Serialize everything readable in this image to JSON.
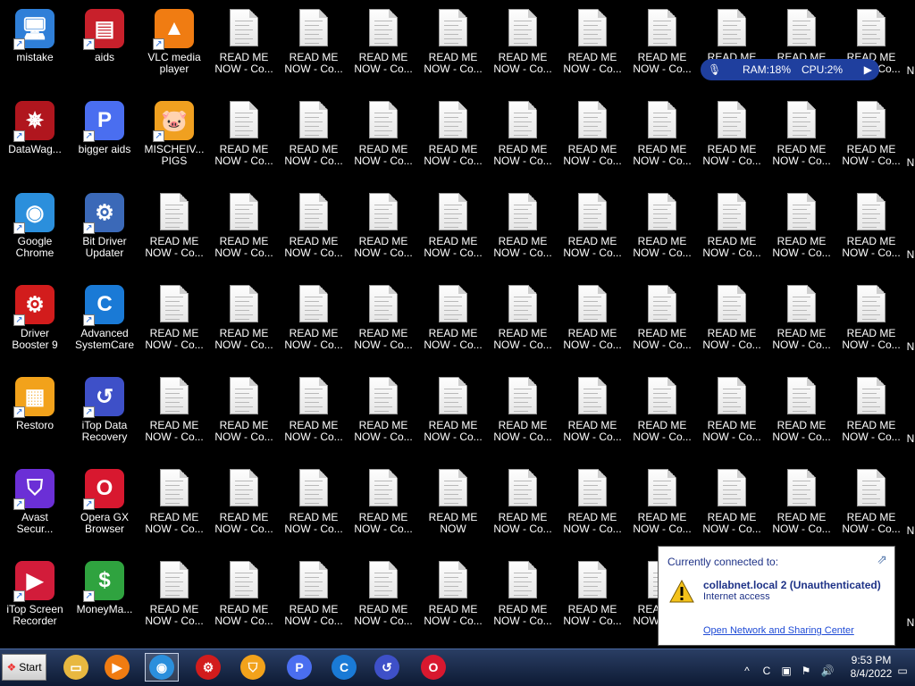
{
  "desktop": {
    "apps": [
      {
        "label": "mistake",
        "icon": "monitor-icon",
        "color": "#2f7fd8",
        "glyph": "🖥"
      },
      {
        "label": "DataWag...",
        "icon": "datawag-star-icon",
        "color": "#b0161e",
        "glyph": "✵"
      },
      {
        "label": "Google\nChrome",
        "icon": "chrome-icon",
        "color": "#2b8fdc",
        "glyph": "◉"
      },
      {
        "label": "Driver\nBooster 9",
        "icon": "driver-booster-icon",
        "color": "#d21c1c",
        "glyph": "⚙"
      },
      {
        "label": "Restoro",
        "icon": "restoro-icon",
        "color": "#f2a21b",
        "glyph": "▦"
      },
      {
        "label": "Avast\nSecur...",
        "icon": "avast-secure-browser-icon",
        "color": "#6b2fd6",
        "glyph": "⛉"
      },
      {
        "label": "iTop Screen\nRecorder",
        "icon": "itop-screen-recorder-icon",
        "color": "#d21c3a",
        "glyph": "▶"
      },
      {
        "label": "aids",
        "icon": "aids-app-icon",
        "color": "#c8202b",
        "glyph": "▤"
      },
      {
        "label": "bigger aids",
        "icon": "p-letter-icon",
        "color": "#4a6ef0",
        "glyph": "P"
      },
      {
        "label": "Bit Driver\nUpdater",
        "icon": "bit-driver-updater-icon",
        "color": "#3b69b8",
        "glyph": "⚙"
      },
      {
        "label": "Advanced\nSystemCare",
        "icon": "advanced-systemcare-icon",
        "color": "#1a7ad6",
        "glyph": "C"
      },
      {
        "label": "iTop Data\nRecovery",
        "icon": "itop-data-recovery-icon",
        "color": "#3e50c8",
        "glyph": "↺"
      },
      {
        "label": "Opera GX\nBrowser",
        "icon": "opera-gx-icon",
        "color": "#d8182f",
        "glyph": "O"
      },
      {
        "label": "MoneyMa...",
        "icon": "money-icon",
        "color": "#2fa33f",
        "glyph": "$"
      },
      {
        "label": "VLC media\nplayer",
        "icon": "vlc-cone-icon",
        "color": "#f07c12",
        "glyph": "▲"
      },
      {
        "label": "MISCHEIV...\nPIGS",
        "icon": "pigs-game-icon",
        "color": "#f0a020",
        "glyph": "🐷"
      }
    ],
    "file_label": "READ ME\nNOW - Co...",
    "file_label_variant": "READ ME\nNOW",
    "partial_label": "N"
  },
  "perf_widget": {
    "ram": "RAM:18%",
    "cpu": "CPU:2%"
  },
  "network_popup": {
    "heading": "Currently connected to:",
    "network_name": "collabnet.local  2 (Unauthenticated)",
    "access": "Internet access",
    "link": "Open Network and Sharing Center"
  },
  "taskbar": {
    "start_label": "Start",
    "pinned": [
      {
        "name": "file-explorer-icon",
        "color": "#e8b840",
        "glyph": "▭"
      },
      {
        "name": "media-player-icon",
        "color": "#f07c12",
        "glyph": "▶"
      },
      {
        "name": "chrome-icon",
        "color": "#2b8fdc",
        "glyph": "◉"
      },
      {
        "name": "driver-booster-icon",
        "color": "#d21c1c",
        "glyph": "⚙"
      },
      {
        "name": "avast-secure-browser-icon",
        "color": "#f2a21b",
        "glyph": "⛉"
      },
      {
        "name": "p-letter-icon",
        "color": "#4a6ef0",
        "glyph": "P"
      },
      {
        "name": "advanced-systemcare-icon",
        "color": "#1a7ad6",
        "glyph": "C"
      },
      {
        "name": "itop-data-recovery-icon",
        "color": "#3e50c8",
        "glyph": "↺"
      },
      {
        "name": "opera-gx-icon",
        "color": "#d8182f",
        "glyph": "O"
      }
    ],
    "clock_time": "9:53 PM",
    "clock_date": "8/4/2022"
  }
}
